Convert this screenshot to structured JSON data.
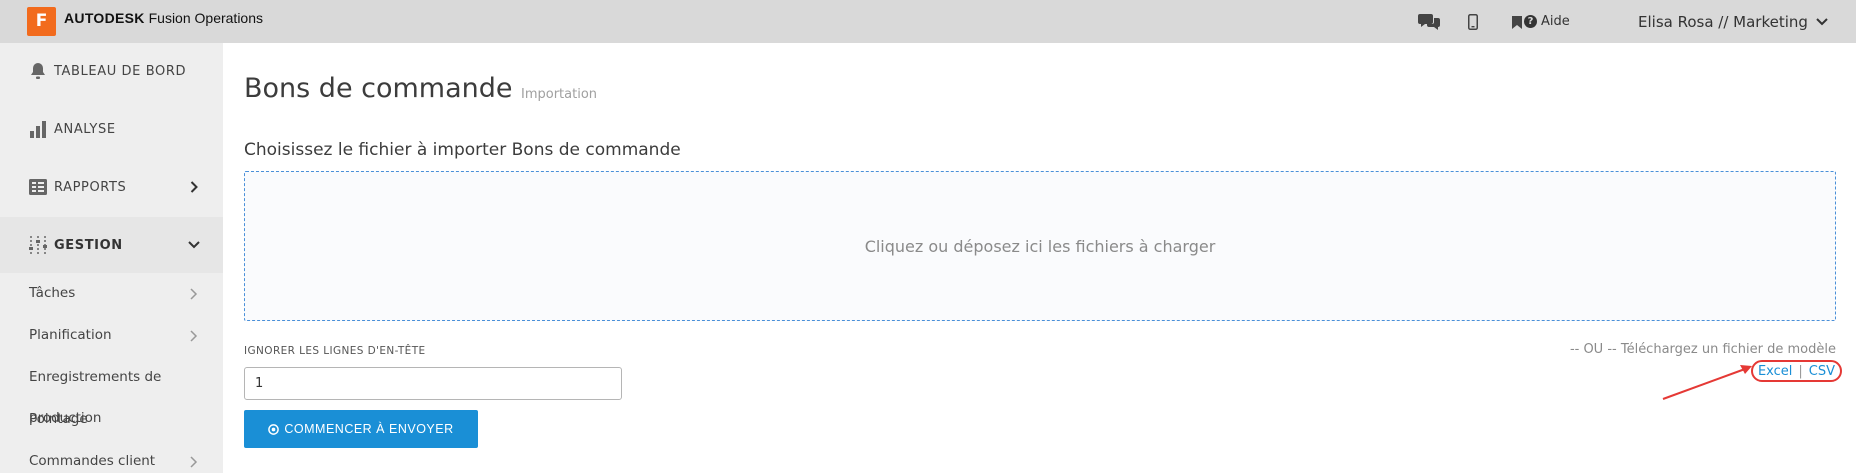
{
  "topbar": {
    "logo_letter": "F",
    "brand_bold": "AUTODESK",
    "brand_rest": "Fusion Operations",
    "help_label": "Aide",
    "user_label": "Elisa Rosa // Marketing",
    "icons": [
      "chat-icon",
      "mobile-icon",
      "bookmark-icon",
      "help-icon",
      "chevron-down-icon"
    ]
  },
  "sidebar": {
    "items": [
      {
        "label": "TABLEAU DE BORD",
        "icon": "bell-icon"
      },
      {
        "label": "ANALYSE",
        "icon": "bar-chart-icon"
      },
      {
        "label": "RAPPORTS",
        "icon": "reports-icon"
      },
      {
        "label": "GESTION",
        "icon": "sliders-icon"
      }
    ],
    "sub_items": [
      {
        "label": "Tâches"
      },
      {
        "label": "Planification"
      },
      {
        "label": "Enregistrements de"
      },
      {
        "label": "production"
      },
      {
        "label": "Pointage"
      },
      {
        "label": "Commandes client"
      }
    ]
  },
  "main": {
    "title": "Bons de commande",
    "subtitle": "Importation",
    "section_title": "Choisissez le fichier à importer Bons de commande",
    "dropzone_text": "Cliquez ou déposez ici les fichiers à charger",
    "header_lines_label": "IGNORER LES LIGNES D'EN-TÊTE",
    "header_lines_value": "1",
    "send_button": "COMMENCER À ENVOYER",
    "template_text": "-- OU -- Téléchargez un fichier de modèle",
    "template_excel": "Excel",
    "template_sep": "|",
    "template_csv": "CSV"
  },
  "colors": {
    "accent": "#1a8fd6",
    "logo": "#f26b1d",
    "annotation": "#e53935"
  }
}
